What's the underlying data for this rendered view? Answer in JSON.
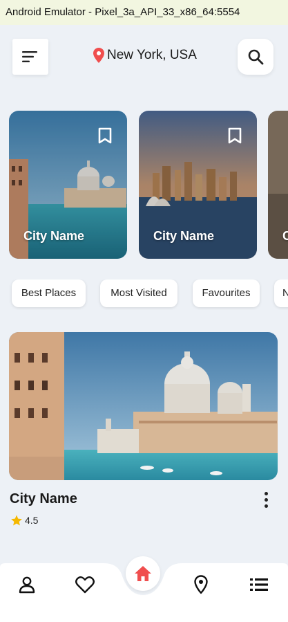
{
  "window": {
    "title": "Android Emulator - Pixel_3a_API_33_x86_64:5554"
  },
  "header": {
    "location": "New York, USA",
    "menu_icon": "menu-icon",
    "search_icon": "search-icon",
    "location_icon": "location-pin-icon"
  },
  "carousel": {
    "cards": [
      {
        "name": "City Name",
        "bookmark_icon": "bookmark-icon"
      },
      {
        "name": "City Name",
        "bookmark_icon": "bookmark-icon"
      },
      {
        "name": "C"
      }
    ]
  },
  "chips": [
    "Best Places",
    "Most Visited",
    "Favourites",
    "N"
  ],
  "featured": {
    "title": "City Name",
    "rating": "4.5",
    "star_icon": "star-icon",
    "more_icon": "more-vertical-icon"
  },
  "bottom_nav": {
    "items": [
      "profile-icon",
      "heart-icon",
      "home-icon",
      "location-pin-icon",
      "list-icon"
    ]
  },
  "colors": {
    "accent": "#f04e4e",
    "background": "#edf1f6",
    "star": "#f5b800"
  }
}
